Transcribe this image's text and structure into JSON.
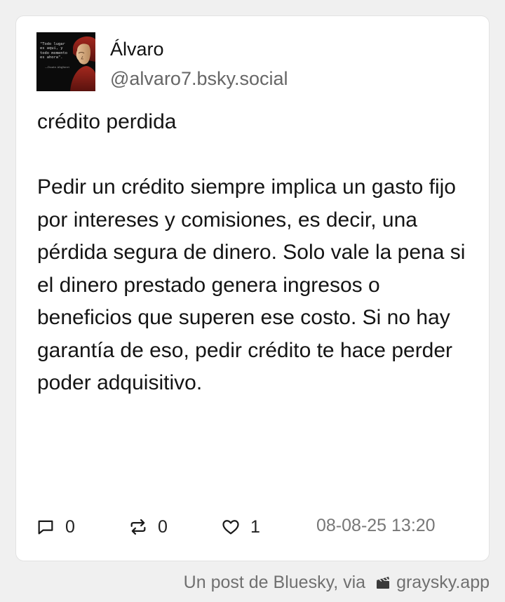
{
  "post": {
    "author": {
      "display_name": "Álvaro",
      "handle": "@alvaro7.bsky.social",
      "avatar": {
        "icon": "avatar-dante-portrait",
        "quote": "\"Todo lugar\nes aquí, y\ntodo momento\nes ahora\".",
        "quote_author": "—Dante Alighieri"
      }
    },
    "title": "crédito perdida",
    "body": "Pedir un crédito siempre implica un gasto fijo por intereses y comisiones, es decir, una pérdida segura de dinero. Solo vale la pena si el dinero prestado genera ingresos o beneficios que superen ese costo. Si no hay garantía de eso, pedir crédito te hace perder poder adquisitivo.",
    "actions": {
      "replies": {
        "icon": "reply-icon",
        "count": "0"
      },
      "reposts": {
        "icon": "repost-icon",
        "count": "0"
      },
      "likes": {
        "icon": "heart-icon",
        "count": "1"
      }
    },
    "timestamp": "08-08-25 13:20"
  },
  "footer": {
    "prefix": "Un post de Bluesky, via",
    "app_icon": "graysky-clapper-icon",
    "app_name": "graysky.app"
  },
  "colors": {
    "page_background": "#f0f0f0",
    "card_background": "#ffffff",
    "primary_text": "#141414",
    "secondary_text": "#666666"
  }
}
